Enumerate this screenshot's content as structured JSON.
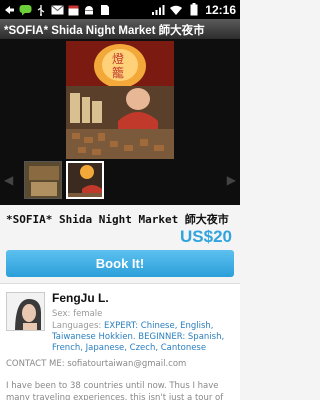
{
  "status_bar": {
    "time": "12:16",
    "left_icons": [
      "back-arrow-icon",
      "messaging-icon",
      "usb-icon",
      "mail-icon",
      "calendar-icon",
      "android-debug-icon",
      "sd-card-icon"
    ],
    "right_icons": [
      "signal-icon",
      "wifi-icon",
      "battery-icon"
    ]
  },
  "app_bar": {
    "title": "*SOFIA* Shida Night Market 師大夜市"
  },
  "gallery": {
    "thumbnail_count": 2,
    "selected_index": 1
  },
  "listing": {
    "title": "*SOFIA* Shida Night Market 師大夜市",
    "price": "US$20",
    "book_button": "Book It!"
  },
  "host": {
    "name": "FengJu L.",
    "sex": "Sex: female",
    "languages_label": "Languages: ",
    "languages": "EXPERT: Chinese, English, Taiwanese Hokkien. BEGINNER: Spanish, French, Japanese, Czech, Cantonese",
    "contact_label": "CONTACT ME: ",
    "contact_email": "sofiatourtaiwan@gmail.com",
    "bio": "I have been to 38 countries until now. Thus I have many traveling experiences, this isn't just a tour of"
  },
  "colors": {
    "accent": "#2fa4de",
    "button": "#3aaae2"
  }
}
